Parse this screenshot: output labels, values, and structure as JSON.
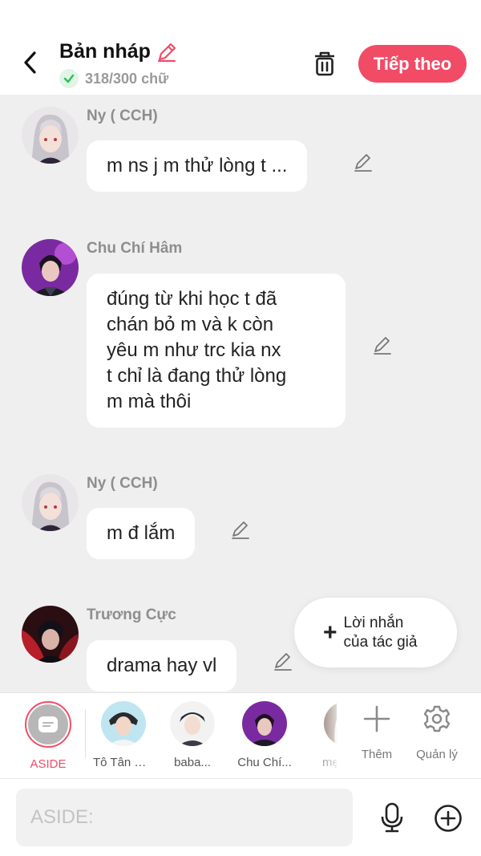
{
  "header": {
    "title": "Bản nháp",
    "word_count": "318/300 chữ",
    "next_label": "Tiếp theo"
  },
  "messages": [
    {
      "sender": "Ny ( CCH)",
      "text": "m ns j m thử lòng t ..."
    },
    {
      "sender": "Chu Chí Hâm",
      "lines": [
        "đúng từ khi học t đã",
        "chán bỏ m và k còn",
        "yêu m như trc kia nx",
        "t chỉ là đang thử lòng",
        "m mà thôi"
      ]
    },
    {
      "sender": "Ny ( CCH)",
      "text": "m đ lắm"
    },
    {
      "sender": "Trương Cực",
      "text": "drama hay vl"
    }
  ],
  "author_note": {
    "line1": "Lời nhắn",
    "line2": "của tác giả"
  },
  "characters": {
    "aside": "ASIDE",
    "items": [
      "Tô Tân Hạo",
      "baba...",
      "Chu Chí...",
      "mẹ"
    ]
  },
  "tools": {
    "add_label": "Thêm",
    "manage_label": "Quản lý"
  },
  "input": {
    "placeholder": "ASIDE:"
  },
  "colors": {
    "accent": "#f24b66",
    "background": "#efefef"
  }
}
